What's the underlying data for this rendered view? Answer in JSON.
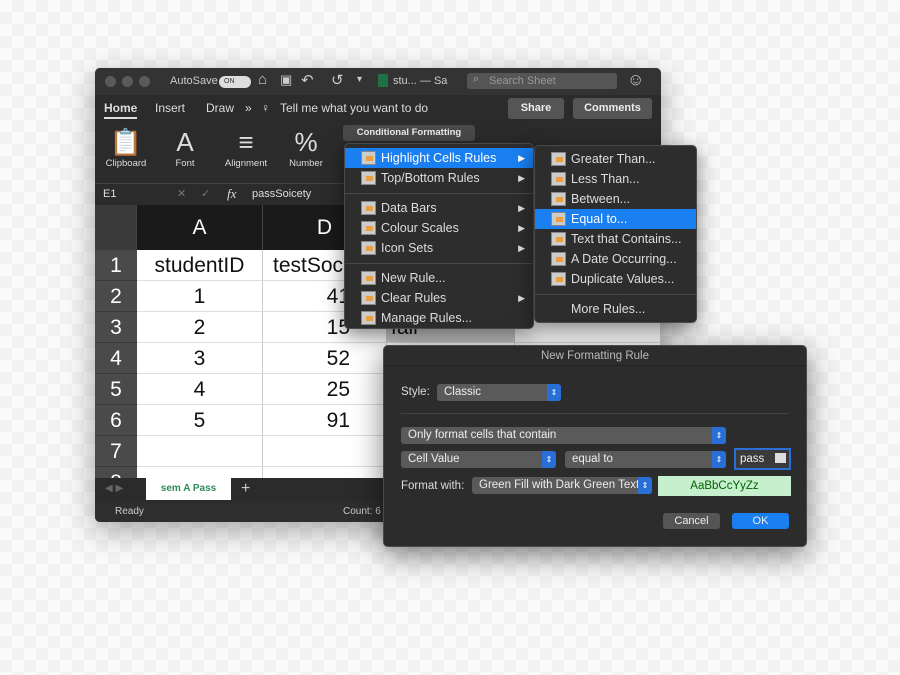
{
  "titlebar": {
    "autosave": "AutoSave",
    "toggle": "ON",
    "file": "stu... — Sa",
    "search_placeholder": "Search Sheet"
  },
  "ribbon": {
    "tabs": [
      "Home",
      "Insert",
      "Draw"
    ],
    "tell_me": "Tell me what you want to do",
    "share": "Share",
    "comments": "Comments",
    "groups": [
      "Clipboard",
      "Font",
      "Alignment",
      "Number"
    ],
    "conditional_formatting": "Conditional Formatting"
  },
  "formula": {
    "cell_ref": "E1",
    "fx": "fx",
    "value": "passSoicety"
  },
  "grid": {
    "columns": [
      "A",
      "D"
    ],
    "rows": [
      "1",
      "2",
      "3",
      "4",
      "5",
      "6",
      "7",
      "8"
    ],
    "col_a": [
      "studentID",
      "1",
      "2",
      "3",
      "4",
      "5"
    ],
    "col_d": [
      "testSoc",
      "41",
      "15",
      "52",
      "25",
      "91"
    ],
    "col_e_row3": "fail"
  },
  "sheet_tab": "sem A Pass",
  "add_sheet": "+",
  "status": {
    "ready": "Ready",
    "count": "Count: 6"
  },
  "cf_menu": {
    "items": [
      "Highlight Cells Rules",
      "Top/Bottom Rules",
      "Data Bars",
      "Colour Scales",
      "Icon Sets",
      "New Rule...",
      "Clear Rules",
      "Manage Rules..."
    ]
  },
  "submenu": {
    "items": [
      "Greater Than...",
      "Less Than...",
      "Between...",
      "Equal to...",
      "Text that Contains...",
      "A Date Occurring...",
      "Duplicate Values...",
      "More Rules..."
    ]
  },
  "dialog": {
    "title": "New Formatting Rule",
    "style_label": "Style:",
    "style_value": "Classic",
    "rule_type": "Only format cells that contain",
    "cell_value": "Cell Value",
    "operator": "equal to",
    "value": "pass",
    "format_label": "Format with:",
    "format_value": "Green Fill with Dark Green Text",
    "preview": "AaBbCcYyZz",
    "cancel": "Cancel",
    "ok": "OK",
    "colors": {
      "preview_bg": "#c6efce",
      "preview_text": "#006100",
      "accent": "#1a7ff0"
    }
  }
}
